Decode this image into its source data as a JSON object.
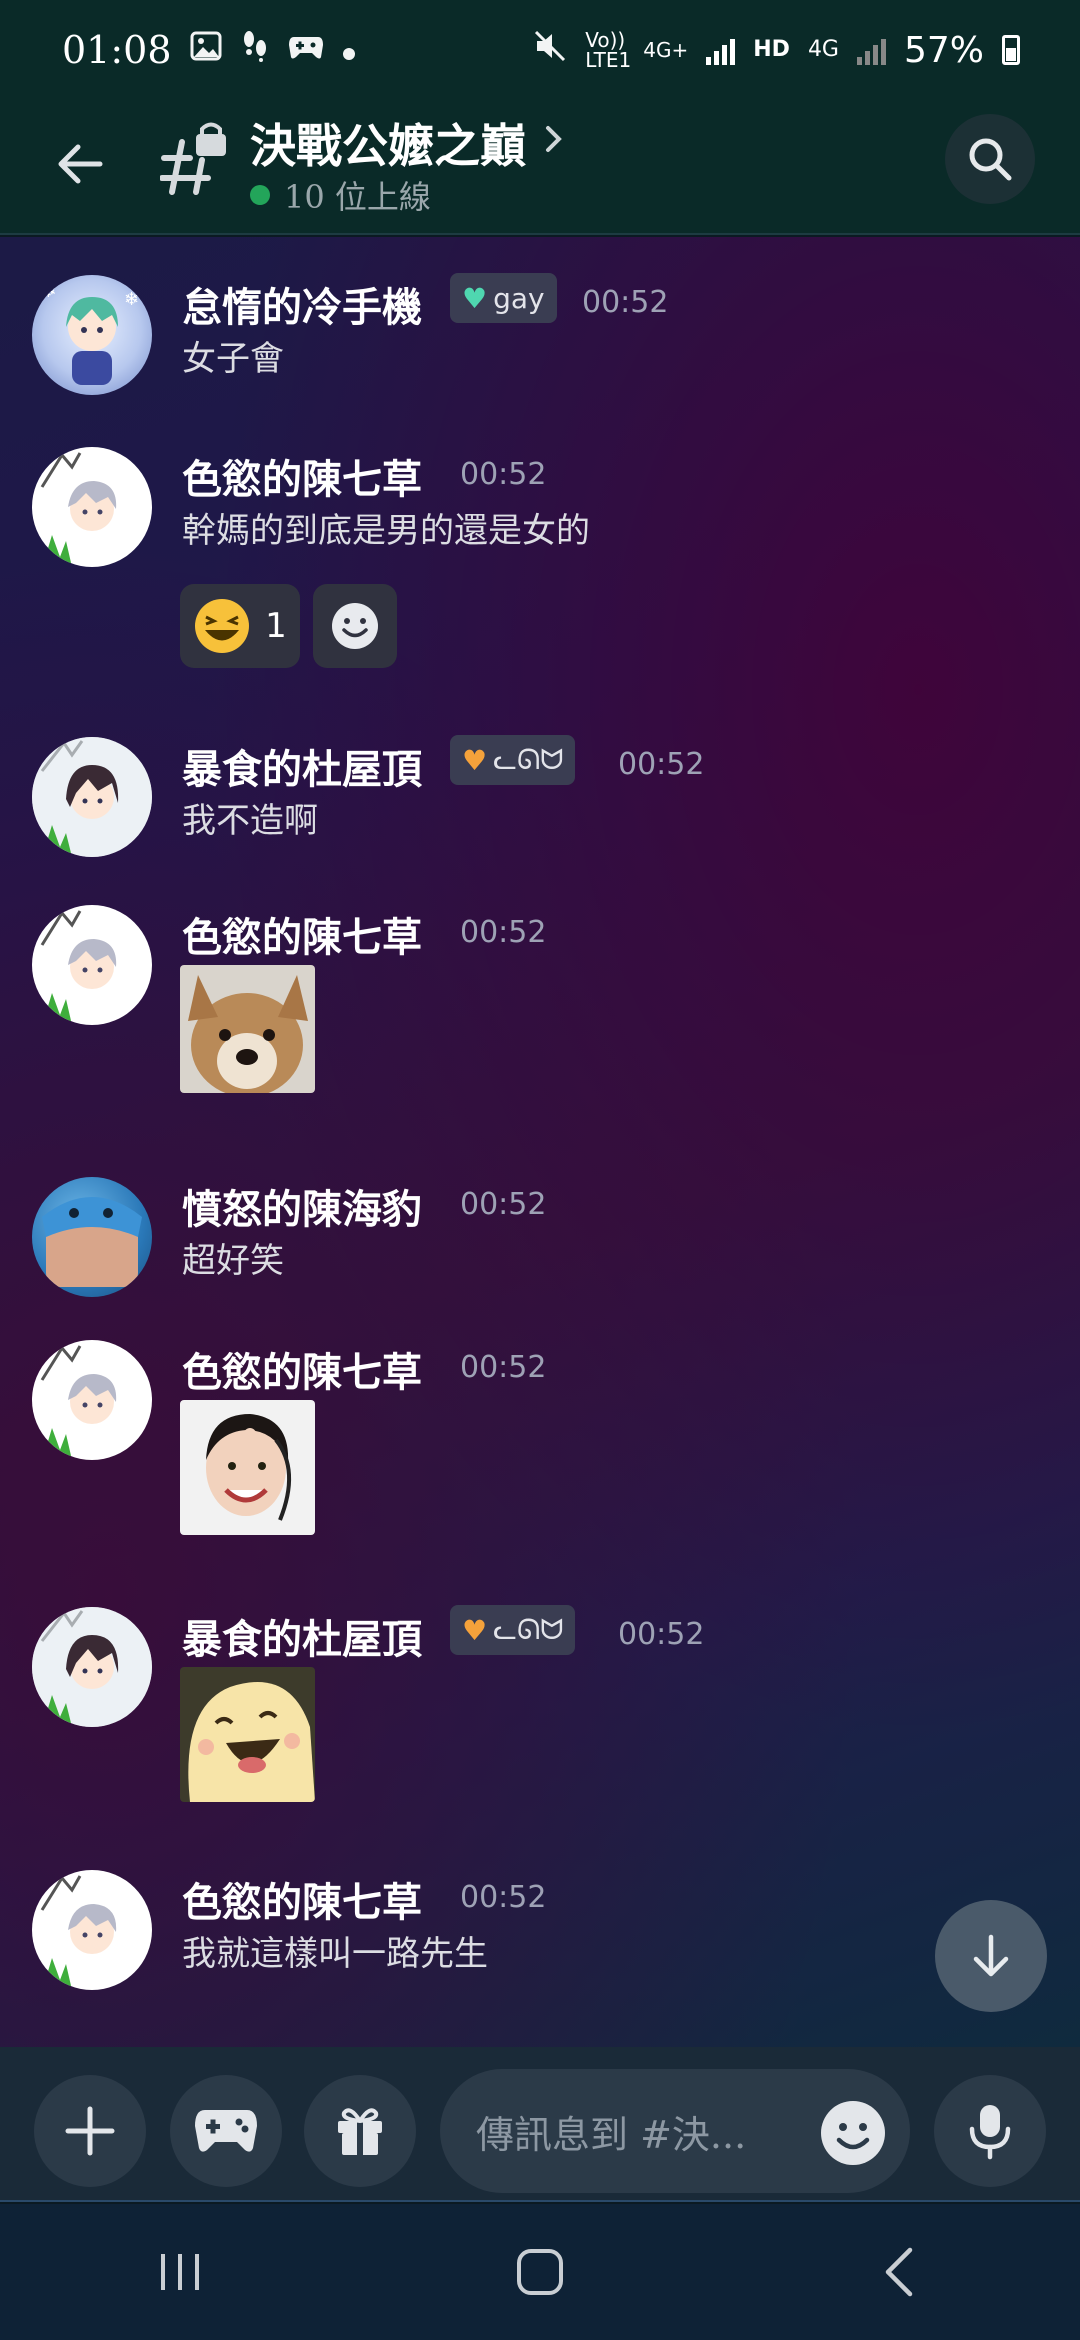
{
  "status_bar": {
    "time": "01:08",
    "battery": "57%",
    "volte_label": "Vo)) LTE1",
    "net_label_1": "4G+",
    "hd_label": "HD",
    "net_label_2": "4G",
    "left_icons": [
      "image-icon",
      "footprint-icon",
      "game-controller-icon",
      "dot-icon"
    ],
    "right_icons": [
      "mute-icon",
      "signal-icon",
      "signal-icon",
      "battery-icon"
    ]
  },
  "header": {
    "title": "決戰公嬤之巔",
    "online_text": "10 位上線",
    "online_color": "#23a55a"
  },
  "messages": [
    {
      "user": "怠惰的冷手機",
      "badge": "gay",
      "badge_heart_color": "#4fd7b0",
      "time": "00:52",
      "text": "女子會",
      "avatar": "anime-ice-avatar"
    },
    {
      "user": "色慾的陳七草",
      "time": "00:52",
      "text": "幹媽的到底是男的還是女的",
      "avatar": "anime-white-hair-avatar",
      "reactions": [
        {
          "emoji": "laughing-emoji",
          "count": "1"
        },
        {
          "emoji": "add-reaction-icon"
        }
      ]
    },
    {
      "user": "暴食的杜屋頂",
      "badge": "ᓚᘏᗢ",
      "badge_heart_color": "#f5a23b",
      "time": "00:52",
      "text": "我不造啊",
      "avatar": "anime-dark-hair-avatar"
    },
    {
      "user": "色慾的陳七草",
      "time": "00:52",
      "media": "corgi-sticker",
      "avatar": "anime-white-hair-avatar"
    },
    {
      "user": "憤怒的陳海豹",
      "time": "00:52",
      "text": "超好笑",
      "avatar": "seal-avatar"
    },
    {
      "user": "色慾的陳七草",
      "time": "00:52",
      "media": "smiling-woman-sticker",
      "avatar": "anime-white-hair-avatar"
    },
    {
      "user": "暴食的杜屋頂",
      "badge": "ᓚᘏᗢ",
      "badge_heart_color": "#f5a23b",
      "time": "00:52",
      "media": "laughing-blob-sticker",
      "avatar": "anime-dark-hair-avatar"
    },
    {
      "user": "色慾的陳七草",
      "time": "00:52",
      "text": "我就這樣叫一路先生",
      "avatar": "anime-white-hair-avatar"
    }
  ],
  "composer": {
    "placeholder": "傳訊息到 #決..."
  },
  "accent_color": "#23a55a"
}
